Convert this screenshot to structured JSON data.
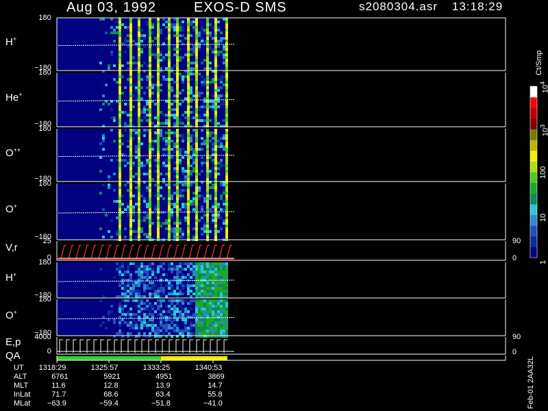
{
  "header": {
    "date": "Aug 03, 1992",
    "mission": "EXOS-D SMS",
    "file": "s2080304.asr",
    "time": "13:18:29"
  },
  "chart_data": {
    "type": "heatmap",
    "panels": [
      {
        "label": "H",
        "charge": "+",
        "ylim": [
          -180,
          180
        ],
        "yticks": [
          "180",
          "−180"
        ],
        "kind": "spec"
      },
      {
        "label": "He",
        "charge": "+",
        "ylim": [
          -180,
          180
        ],
        "yticks": [
          "180",
          "−180"
        ],
        "kind": "spec"
      },
      {
        "label": "O",
        "charge": "++",
        "ylim": [
          -180,
          180
        ],
        "yticks": [
          "180",
          "−180"
        ],
        "kind": "spec"
      },
      {
        "label": "O",
        "charge": "+",
        "ylim": [
          -180,
          180
        ],
        "yticks": [
          "180",
          "−180"
        ],
        "kind": "spec"
      },
      {
        "label": "V,r",
        "charge": "",
        "yticks": [
          "25",
          "0"
        ],
        "right_ticks": [
          "90",
          "0"
        ],
        "kind": "line"
      },
      {
        "label": "H",
        "charge": "+",
        "ylim": [
          -180,
          180
        ],
        "yticks": [
          "180",
          "−180"
        ],
        "kind": "spec2"
      },
      {
        "label": "O",
        "charge": "+",
        "ylim": [
          -180,
          180
        ],
        "yticks": [
          "180",
          "−180"
        ],
        "kind": "spec2"
      },
      {
        "label": "E,p",
        "charge": "",
        "yticks": [
          "4000",
          "0"
        ],
        "right_ticks": [
          "90",
          "0"
        ],
        "kind": "step"
      },
      {
        "label": "QA",
        "charge": "",
        "kind": "qa"
      }
    ],
    "colorbar": {
      "unit": "Ct/Smp",
      "ticks": [
        {
          "base": "10",
          "exp": "4",
          "value": 10000
        },
        {
          "base": "10",
          "exp": "3",
          "value": 1000
        },
        {
          "base": "100",
          "exp": "",
          "value": 100
        },
        {
          "base": "10",
          "exp": "",
          "value": 10
        },
        {
          "base": "1",
          "exp": "",
          "value": 1
        }
      ],
      "scale": "log",
      "colors": [
        "#000080",
        "#0a2a9a",
        "#1f4fc0",
        "#2a8ad0",
        "#25c8d8",
        "#118a50",
        "#1ca82a",
        "#50c820",
        "#a8e010",
        "#f0f000",
        "#b8b800",
        "#7a7a00",
        "#800000",
        "#c00000",
        "#ff0000",
        "#ffffff"
      ]
    },
    "time_axis": {
      "rows": [
        {
          "name": "UT",
          "values": [
            "1318:29",
            "1325:57",
            "1333:25",
            "1340:53"
          ]
        },
        {
          "name": "ALT",
          "values": [
            "6761",
            "5921",
            "4951",
            "3869"
          ]
        },
        {
          "name": "MLT",
          "values": [
            "11.6",
            "12.8",
            "13.9",
            "14.7"
          ]
        },
        {
          "name": "InLat",
          "values": [
            "71.7",
            "68.6",
            "63.4",
            "55.8"
          ]
        },
        {
          "name": "MLat",
          "values": [
            "−63.9",
            "−59.4",
            "−51.8",
            "−41.0"
          ]
        }
      ]
    },
    "data_end_fraction": 0.38
  },
  "footer": {
    "stamp": "Feb-01  2AA32L"
  }
}
